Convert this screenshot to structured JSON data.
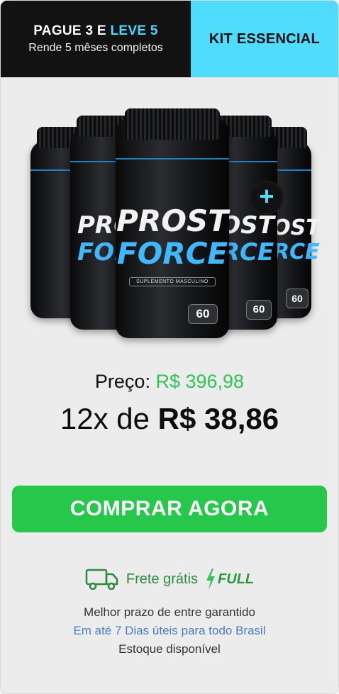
{
  "header": {
    "promo_prefix": "PAGUE 3 E ",
    "promo_accent": "LEVE 5",
    "promo_subtitle": "Rende 5 mêses completos",
    "kit_label": "KIT ESSENCIAL",
    "accent_color": "#4fdcff"
  },
  "product": {
    "brand_line1": "PROST",
    "brand_line2": "FORCE",
    "label_text": "SUPLEMENTO MASCULINO",
    "capsule_count": "60",
    "bottle_count": 5,
    "plus_symbol": "+"
  },
  "pricing": {
    "price_label": "Preço:",
    "price_value": "R$ 396,98",
    "installment_prefix": "12x de",
    "installment_value": "R$ 38,86",
    "price_color": "#2fc35a"
  },
  "cta": {
    "button_label": "COMPRAR AGORA",
    "button_color": "#27c74c"
  },
  "shipping": {
    "icon": "truck-icon",
    "free_label": "Frete grátis",
    "full_label": "FULL",
    "full_icon": "lightning-icon"
  },
  "info": {
    "line1": "Melhor prazo de entre garantido",
    "line2": "Em até 7 Dias úteis para todo Brasil",
    "line3": "Estoque disponível"
  }
}
